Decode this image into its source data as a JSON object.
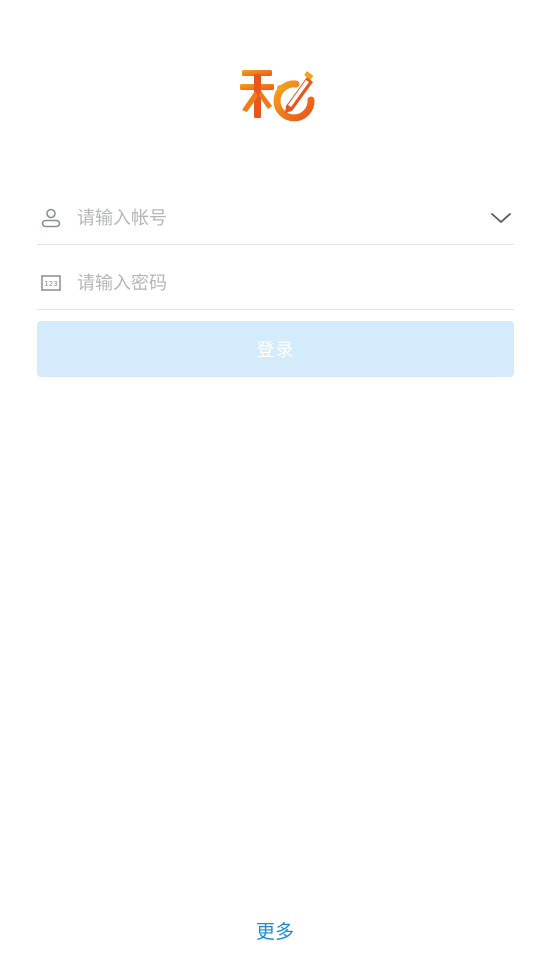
{
  "logo": {
    "icon": "app-logo-icon",
    "colors": [
      "#e8561b",
      "#f7a21b",
      "#ffffff"
    ]
  },
  "login_form": {
    "account": {
      "icon": "user-icon",
      "placeholder": "请输入帐号",
      "value": "",
      "dropdown_icon": "chevron-down-icon"
    },
    "password": {
      "icon": "keypad-123-icon",
      "placeholder": "请输入密码",
      "value": ""
    },
    "login_button": {
      "label": "登录",
      "state": "disabled",
      "color": "#d3ebfa"
    }
  },
  "footer": {
    "more_label": "更多",
    "link_color": "#1a8bd8"
  }
}
